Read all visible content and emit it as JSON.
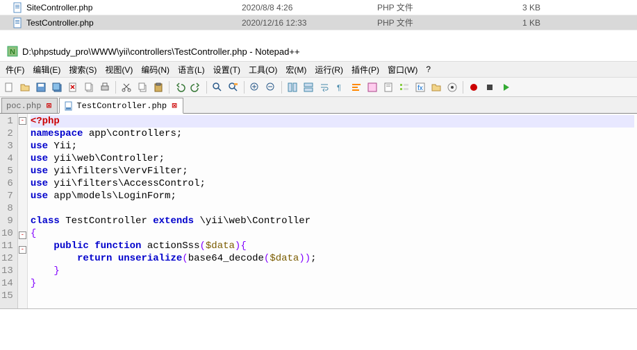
{
  "explorer": {
    "rows": [
      {
        "name": "SiteController.php",
        "date": "2020/8/8 4:26",
        "type": "PHP 文件",
        "size": "3 KB",
        "selected": false
      },
      {
        "name": "TestController.php",
        "date": "2020/12/16 12:33",
        "type": "PHP 文件",
        "size": "1 KB",
        "selected": true
      }
    ]
  },
  "window": {
    "title": "D:\\phpstudy_pro\\WWW\\yii\\controllers\\TestController.php - Notepad++"
  },
  "menu": {
    "file": "件(F)",
    "edit": "编辑(E)",
    "search": "搜索(S)",
    "view": "视图(V)",
    "encoding": "编码(N)",
    "language": "语言(L)",
    "settings": "设置(T)",
    "tools": "工具(O)",
    "macro": "宏(M)",
    "run": "运行(R)",
    "plugins": "插件(P)",
    "window": "窗口(W)",
    "help": "?"
  },
  "tabs": {
    "inactive": "poc.php",
    "active": "TestController.php"
  },
  "code": {
    "lines": [
      {
        "n": "1",
        "html": "<span class='php-tag'>&lt;?php</span>",
        "fold": "box",
        "current": true
      },
      {
        "n": "2",
        "html": "<span class='kw'>namespace</span> app\\controllers;"
      },
      {
        "n": "3",
        "html": "<span class='kw'>use</span> Yii;"
      },
      {
        "n": "4",
        "html": "<span class='kw'>use</span> yii\\web\\Controller;"
      },
      {
        "n": "5",
        "html": "<span class='kw'>use</span> yii\\filters\\VervFilter;"
      },
      {
        "n": "6",
        "html": "<span class='kw'>use</span> yii\\filters\\AccessControl;"
      },
      {
        "n": "7",
        "html": "<span class='kw'>use</span> app\\models\\LoginForm;"
      },
      {
        "n": "8",
        "html": ""
      },
      {
        "n": "9",
        "html": "<span class='kw'>class</span> TestController <span class='kw'>extends</span> \\yii\\web\\Controller"
      },
      {
        "n": "10",
        "html": "<span class='op'>{</span>",
        "fold": "box"
      },
      {
        "n": "11",
        "html": "    <span class='kw'>public</span> <span class='kw'>function</span> actionSss<span class='paren'>(</span><span class='var'>$data</span><span class='paren'>)</span><span class='op'>{</span>",
        "fold": "box"
      },
      {
        "n": "12",
        "html": "        <span class='kw'>return</span> <span class='kw'>unserialize</span><span class='paren'>(</span>base64_decode<span class='paren'>(</span><span class='var'>$data</span><span class='paren'>))</span>;"
      },
      {
        "n": "13",
        "html": "    <span class='op'>}</span>"
      },
      {
        "n": "14",
        "html": "<span class='op'>}</span>"
      },
      {
        "n": "15",
        "html": ""
      }
    ]
  }
}
